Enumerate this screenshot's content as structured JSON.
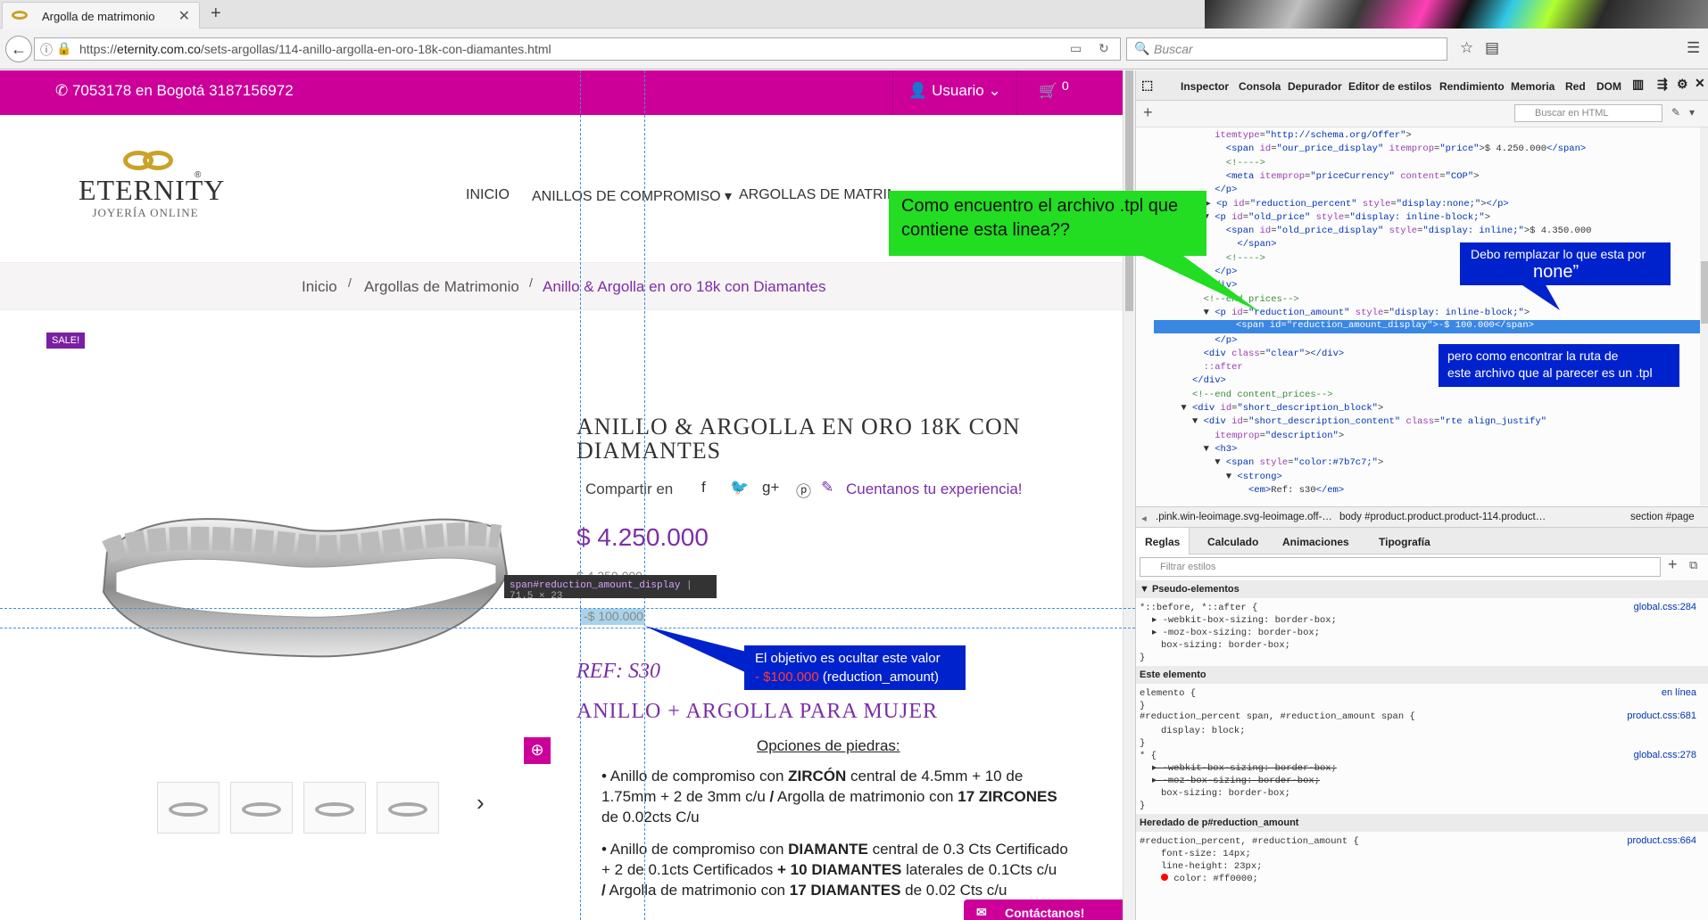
{
  "browser": {
    "tab_title": "Argolla de matrimonio",
    "new_tab": "+",
    "tab_close": "✕",
    "url_prefix": "https://",
    "url_domain": "eternity.com.co",
    "url_path": "/sets-argollas/114-anillo-argolla-en-oro-18k-con-diamantes.html",
    "search_placeholder": "Buscar",
    "icons": [
      "back-icon",
      "info-icon",
      "lock-icon",
      "reader-icon",
      "reload-icon",
      "search-icon",
      "star-icon",
      "menu-icon"
    ]
  },
  "site": {
    "phones": "7053178 en Bogotá 3187156972",
    "user_label": "Usuario",
    "cart_count": "0",
    "logo_name": "ETERNITY",
    "logo_reg": "®",
    "logo_sub": "JOYERÍA ONLINE",
    "menu": [
      "INICIO",
      "ANILLOS DE COMPROMISO",
      "ARGOLLAS DE MATRIMO"
    ],
    "breadcrumb": [
      "Inicio",
      "Argollas de Matrimonio",
      "Anillo & Argolla en oro 18k con Diamantes"
    ],
    "breadcrumb_sep": "/",
    "sale_badge": "SALE!",
    "product_title": "ANILLO & ARGOLLA EN ORO 18K CON DIAMANTES",
    "share_label": "Compartir en",
    "experience_link": "Cuentanos tu experiencia!",
    "price": "$ 4.250.000",
    "old_price": "$ 4.350.000",
    "reduction": "-$ 100.000",
    "ref": "REF: S30",
    "subtitle": "ANILLO + ARGOLLA PARA MUJER",
    "options_heading": "Opciones de piedras:",
    "bullets": [
      [
        "Anillo de compromiso con ",
        "ZIRCÓN",
        " central de 4.5mm + 10 de"
      ],
      [
        "1.75mm  + 2 de 3mm c/u ",
        "/",
        " Argolla de matrimonio con ",
        "17 ZIRCONES"
      ],
      [
        " de 0.02cts C/u"
      ],
      [
        "Anillo de compromiso con ",
        "DIAMANTE",
        " central de 0.3 Cts Certificado"
      ],
      [
        "+ 2 de 0.1cts  Certificados ",
        "+ 10 DIAMANTES",
        " laterales de 0.1Cts c/u"
      ],
      [
        "/",
        " Argolla de matrimonio con ",
        "17 DIAMANTES",
        "  de 0.02 Cts  c/u"
      ]
    ],
    "contact_button": "Contáctanos!",
    "next_arrow": "›"
  },
  "inspector_tooltip": {
    "selector": "span#reduction_amount_display",
    "size": "71.5 × 23"
  },
  "devtools": {
    "tabs": [
      "Inspector",
      "Consola",
      "Depurador",
      "Editor de estilos",
      "Rendimiento",
      "Memoria",
      "Red",
      "DOM"
    ],
    "html_search_placeholder": "Buscar en HTML",
    "markup_lines": [
      {
        "indent": 14,
        "html": "<span class=\"at\">itemtype</span>=<span class=\"vl\">\"http://schema.org/Offer\"</span>&gt;"
      },
      {
        "indent": 16,
        "html": "<span class=\"tg\">&lt;span</span> <span class=\"at\">id</span>=<span class=\"vl\">\"our_price_display\"</span> <span class=\"at\">itemprop</span>=<span class=\"vl\">\"price\"</span>&gt;$ 4.250.000<span class=\"tg\">&lt;/span&gt;</span>"
      },
      {
        "indent": 16,
        "html": "<span class=\"cm\">&lt;!----&gt;</span>"
      },
      {
        "indent": 16,
        "html": "<span class=\"tg\">&lt;meta</span> <span class=\"at\">itemprop</span>=<span class=\"vl\">\"priceCurrency\"</span> <span class=\"at\">content</span>=<span class=\"vl\">\"COP\"</span>&gt;"
      },
      {
        "indent": 14,
        "html": "<span class=\"tg\">&lt;/p&gt;</span>"
      },
      {
        "indent": 12,
        "html": "▶ <span class=\"tg\">&lt;p</span> <span class=\"at\">id</span>=<span class=\"vl\">\"reduction_percent\"</span> <span class=\"at\">style</span>=<span class=\"vl\">\"display:none;\"</span>&gt;<span class=\"tg\">&lt;/p&gt;</span>"
      },
      {
        "indent": 12,
        "html": "▼ <span class=\"tg\">&lt;p</span> <span class=\"at\">id</span>=<span class=\"vl\">\"old_price\"</span> <span class=\"at\">style</span>=<span class=\"vl\">\"display: inline-block;\"</span>&gt;"
      },
      {
        "indent": 16,
        "html": "<span class=\"tg\">&lt;span</span> <span class=\"at\">id</span>=<span class=\"vl\">\"old_price_display\"</span> <span class=\"at\">style</span>=<span class=\"vl\">\"display: inline;\"</span>&gt;$ 4.350.000"
      },
      {
        "indent": 18,
        "html": "<span class=\"tg\">&lt;/span&gt;</span>"
      },
      {
        "indent": 16,
        "html": "<span class=\"cm\">&lt;!----&gt;</span>"
      },
      {
        "indent": 14,
        "html": "<span class=\"tg\">&lt;/p&gt;</span>"
      },
      {
        "indent": 12,
        "html": "<span class=\"tg\">&lt;/div&gt;</span>"
      },
      {
        "indent": 12,
        "html": "<span class=\"cm\">&lt;!--end prices--&gt;</span>"
      },
      {
        "indent": 12,
        "html": "▼ <span class=\"tg\">&lt;p</span> <span class=\"at\">id</span>=<span class=\"vl\">\"reduction_amount\"</span> <span class=\"at\">style</span>=<span class=\"vl\">\"display: inline-block;\"</span>&gt;"
      },
      {
        "indent": 16,
        "html": "SELECTED"
      },
      {
        "indent": 14,
        "html": "<span class=\"tg\">&lt;/p&gt;</span>"
      },
      {
        "indent": 12,
        "html": "<span class=\"tg\">&lt;div</span> <span class=\"at\">class</span>=<span class=\"vl\">\"clear\"</span>&gt;<span class=\"tg\">&lt;/div&gt;</span>"
      },
      {
        "indent": 12,
        "html": "<span class=\"at\">::after</span>"
      },
      {
        "indent": 10,
        "html": "<span class=\"tg\">&lt;/div&gt;</span>"
      },
      {
        "indent": 10,
        "html": "<span class=\"cm\">&lt;!--end content_prices--&gt;</span>"
      },
      {
        "indent": 8,
        "html": "▼ <span class=\"tg\">&lt;div</span> <span class=\"at\">id</span>=<span class=\"vl\">\"short_description_block\"</span>&gt;"
      },
      {
        "indent": 10,
        "html": "▼ <span class=\"tg\">&lt;div</span> <span class=\"at\">id</span>=<span class=\"vl\">\"short_description_content\"</span> <span class=\"at\">class</span>=<span class=\"vl\">\"rte align_justify\"</span>"
      },
      {
        "indent": 14,
        "html": "<span class=\"at\">itemprop</span>=<span class=\"vl\">\"description\"</span>&gt;"
      },
      {
        "indent": 12,
        "html": "▼ <span class=\"tg\">&lt;h3&gt;</span>"
      },
      {
        "indent": 14,
        "html": "▼ <span class=\"tg\">&lt;span</span> <span class=\"at\">style</span>=<span class=\"vl\">\"color:#7b7c7;\"</span>&gt;"
      },
      {
        "indent": 16,
        "html": "▼ <span class=\"tg\">&lt;strong&gt;</span>"
      },
      {
        "indent": 20,
        "html": "<span class=\"tg\">&lt;em&gt;</span>Ref: s30<span class=\"tg\">&lt;/em&gt;</span>"
      }
    ],
    "selected_line": "<span id=\"reduction_amount_display\">-$ 100.000</span>",
    "breadcrumb_items": [
      ".pink.win-leoimage.svg-leoimage.off-…",
      "body #product.product.product-114.product…",
      "section #page"
    ],
    "rules_tabs": [
      "Reglas",
      "Calculado",
      "Animaciones",
      "Tipografía"
    ],
    "filter_placeholder": "Filtrar estilos",
    "sections": [
      {
        "title": "Pseudo-elementos"
      },
      {
        "title": "Este elemento"
      },
      {
        "title": "Heredado de p#reduction_amount"
      }
    ],
    "rules": {
      "pseudo_selector": "*::before, *::after {",
      "pseudo_decls": [
        "-webkit-box-sizing: border-box;",
        "-moz-box-sizing: border-box;",
        "box-sizing: border-box;"
      ],
      "pseudo_src": "global.css:284",
      "elem_selector": "elemento {",
      "elem_src": "en línea",
      "close": "}",
      "red_selector": "#reduction_percent span, #reduction_amount span {",
      "red_decl": "display: block;",
      "red_src": "product.css:681",
      "star_selector": "* {",
      "star_decls": [
        "-webkit-box-sizing: border-box;",
        "-moz-box-sizing: border-box;",
        "box-sizing: border-box;"
      ],
      "star_src": "global.css:278",
      "inh_selector": "#reduction_percent, #reduction_amount {",
      "inh_decls": [
        "font-size: 14px;",
        "line-height: 23px;",
        "color: #ff0000;"
      ],
      "inh_src": "product.css:664"
    }
  },
  "annotations": {
    "green_question": "Como encuentro el archivo .tpl que contiene esta linea??",
    "replace_line1": "Debo remplazar lo que esta por",
    "replace_line2": "none”",
    "path_question_1": "pero como encontrar la ruta de",
    "path_question_2": "este archivo que al parecer es un .tpl",
    "objective_1": "El objetivo es ocultar este valor",
    "objective_value": "- $100.000",
    "objective_tail": " (reduction_amount)"
  },
  "colors": {
    "brand_magenta": "#cc0099",
    "brand_purple": "#7b2fa6",
    "annotation_green": "#22dd22",
    "annotation_blue": "#0022cc",
    "devtools_selection": "#3a87e3"
  }
}
